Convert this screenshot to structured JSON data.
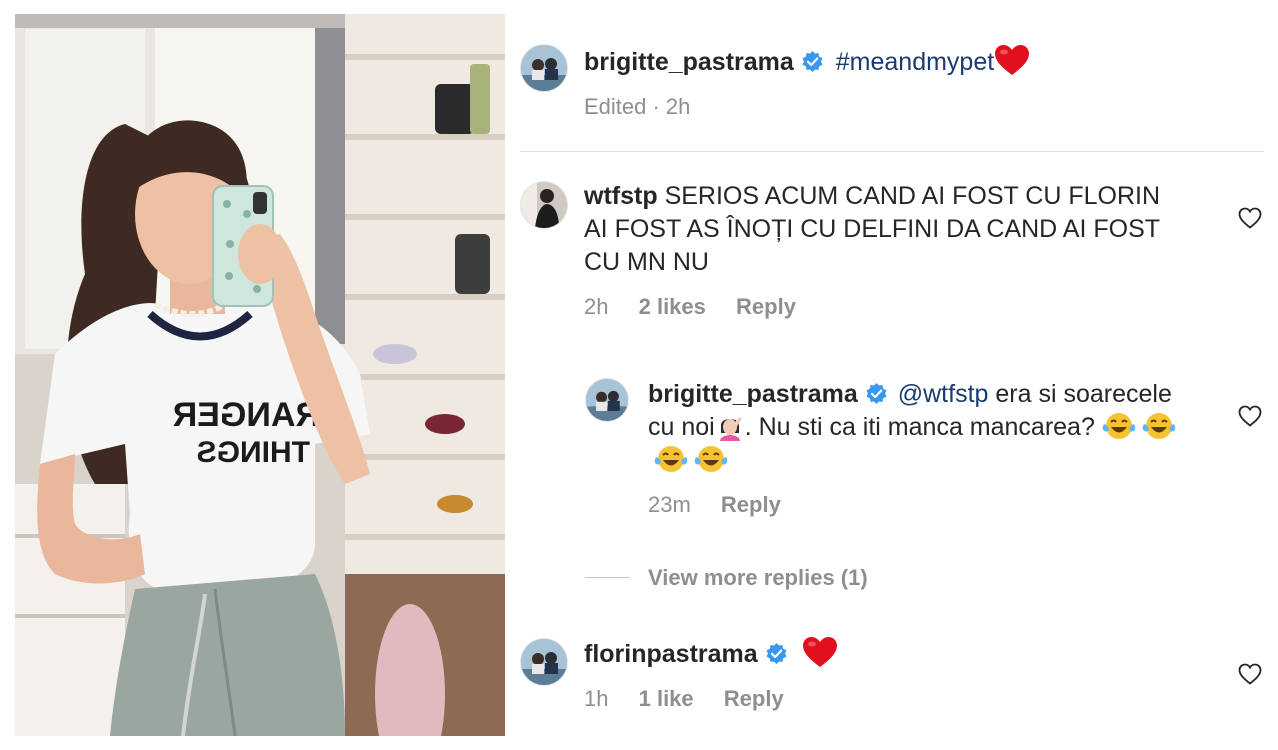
{
  "post": {
    "username": "brigitte_pastrama",
    "caption": "#meandmypet",
    "meta": "Edited · 2h"
  },
  "comments": [
    {
      "username": "wtfstp",
      "text": "SERIOS ACUM CAND AI FOST CU FLORIN AI FOST AS ÎNOȚI CU DELFINI DA CAND AI FOST CU MN NU",
      "time": "2h",
      "likes": "2 likes",
      "reply_label": "Reply"
    },
    {
      "username": "brigitte_pastrama",
      "mention": "@wtfstp",
      "text_part1": "era si soarecele cu noi",
      "text_part2": ". Nu sti ca iti manca mancarea?",
      "time": "23m",
      "reply_label": "Reply"
    },
    {
      "view_more": "View more replies (1)"
    },
    {
      "username": "florinpastrama",
      "time": "1h",
      "likes": "1 like",
      "reply_label": "Reply"
    }
  ],
  "icons": {
    "verified": "verified-badge-icon",
    "like": "heart-outline-icon",
    "red_heart": "red-heart-emoji",
    "facepalm": "facepalm-emoji",
    "laughing": "tears-of-joy-emoji"
  },
  "colors": {
    "text": "#262626",
    "muted": "#8e8e8e",
    "link": "#1a3b6e",
    "verified": "#3897f0",
    "heart_red": "#e0101f"
  }
}
